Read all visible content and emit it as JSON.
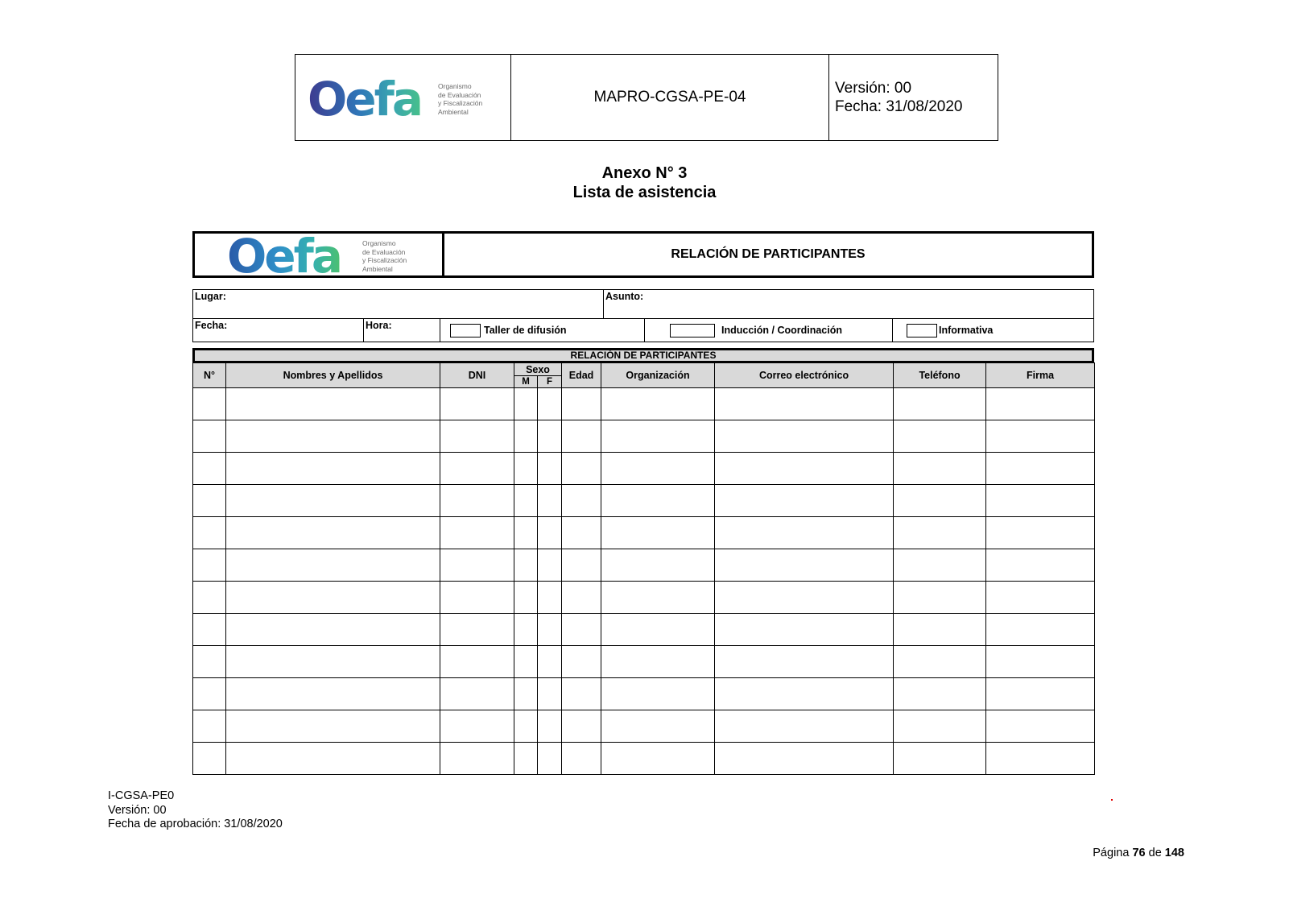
{
  "header": {
    "code": "MAPRO-CGSA-PE-04",
    "version": "Versión: 00",
    "date": "Fecha: 31/08/2020"
  },
  "logo": {
    "wordmark": "Oefa",
    "subtitle_lines": [
      "Organismo",
      "de Evaluación",
      "y Fiscalización",
      "Ambiental"
    ],
    "colors": [
      "#3d3a8f",
      "#2f76b8",
      "#3aa6b0",
      "#47c08a"
    ]
  },
  "titles": {
    "line1": "Anexo N° 3",
    "line2": "Lista de asistencia"
  },
  "form": {
    "title": "RELACIÓN DE PARTICIPANTES",
    "lugar": "Lugar:",
    "asunto": "Asunto:",
    "fecha": "Fecha:",
    "hora": "Hora:",
    "options": [
      "Taller de difusión",
      "Inducción / Coordinación",
      "Informativa"
    ],
    "band_title": "RELACIÓN DE PARTICIPANTES",
    "columns": {
      "num": "N°",
      "names": "Nombres y Apellidos",
      "dni": "DNI",
      "sexo": "Sexo",
      "m": "M",
      "f": "F",
      "edad": "Edad",
      "org": "Organización",
      "email": "Correo electrónico",
      "phone": "Teléfono",
      "firma": "Firma"
    }
  },
  "footer": {
    "doc_code": "I-CGSA-PE0",
    "version": "Versión: 00",
    "approval": "Fecha de aprobación: 31/08/2020",
    "page_label": "Página",
    "page_current": "76",
    "page_of": "de",
    "page_total": "148"
  }
}
